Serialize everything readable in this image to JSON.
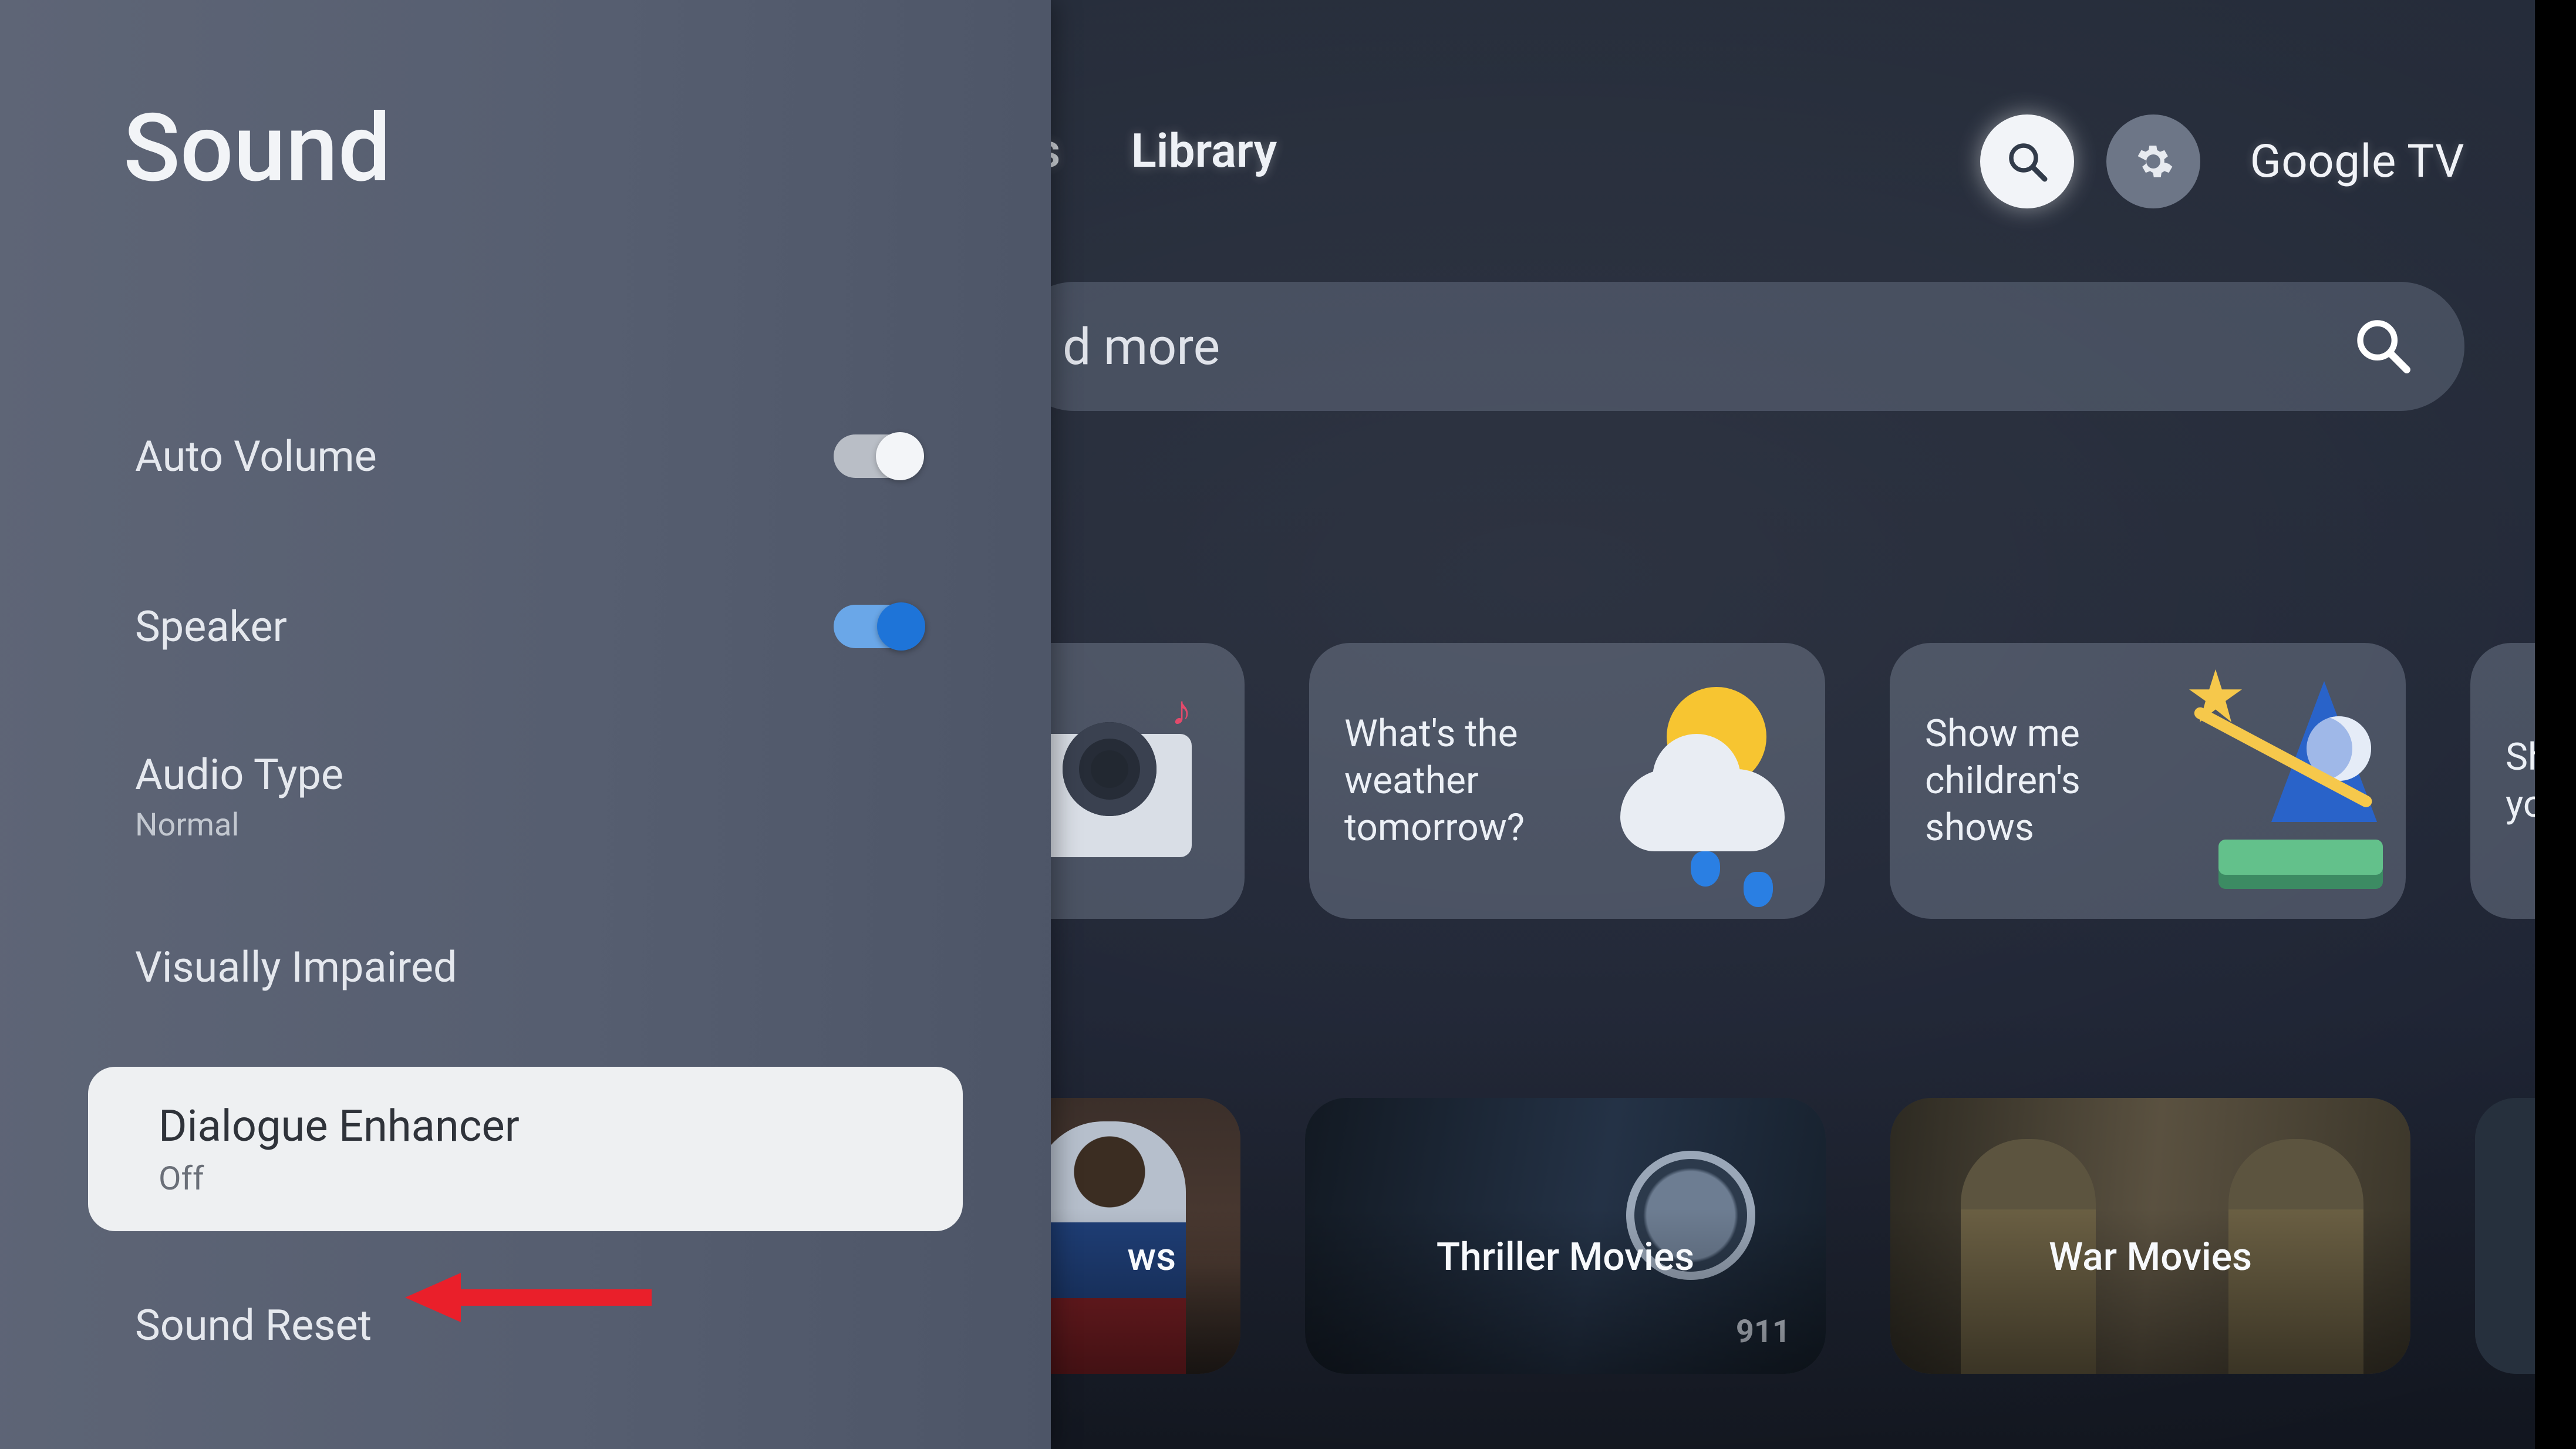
{
  "topbar": {
    "tab_partial": "os",
    "tab_library": "Library",
    "brand_google": "Google",
    "brand_tv": " TV"
  },
  "search": {
    "placeholder_fragment": "d more"
  },
  "cards": {
    "weather": "What's the weather tomorrow?",
    "kids": "Show me children's shows",
    "yoga_fragment": "Sho\nyoga"
  },
  "genres": {
    "g1_fragment": "ws",
    "thriller": "Thriller Movies",
    "war": "War Movies",
    "badge911": "911"
  },
  "panel": {
    "title": "Sound",
    "auto_volume": "Auto Volume",
    "speaker": "Speaker",
    "audio_type": "Audio Type",
    "audio_type_value": "Normal",
    "visually_impaired": "Visually Impaired",
    "dialogue_enhancer": "Dialogue Enhancer",
    "dialogue_enhancer_value": "Off",
    "sound_reset": "Sound Reset",
    "toggles": {
      "auto_volume": "off",
      "speaker": "on"
    }
  },
  "colors": {
    "panel_bg": "#5a6273",
    "accent_blue": "#1e74d8",
    "annotation_red": "#ea1f2a"
  }
}
